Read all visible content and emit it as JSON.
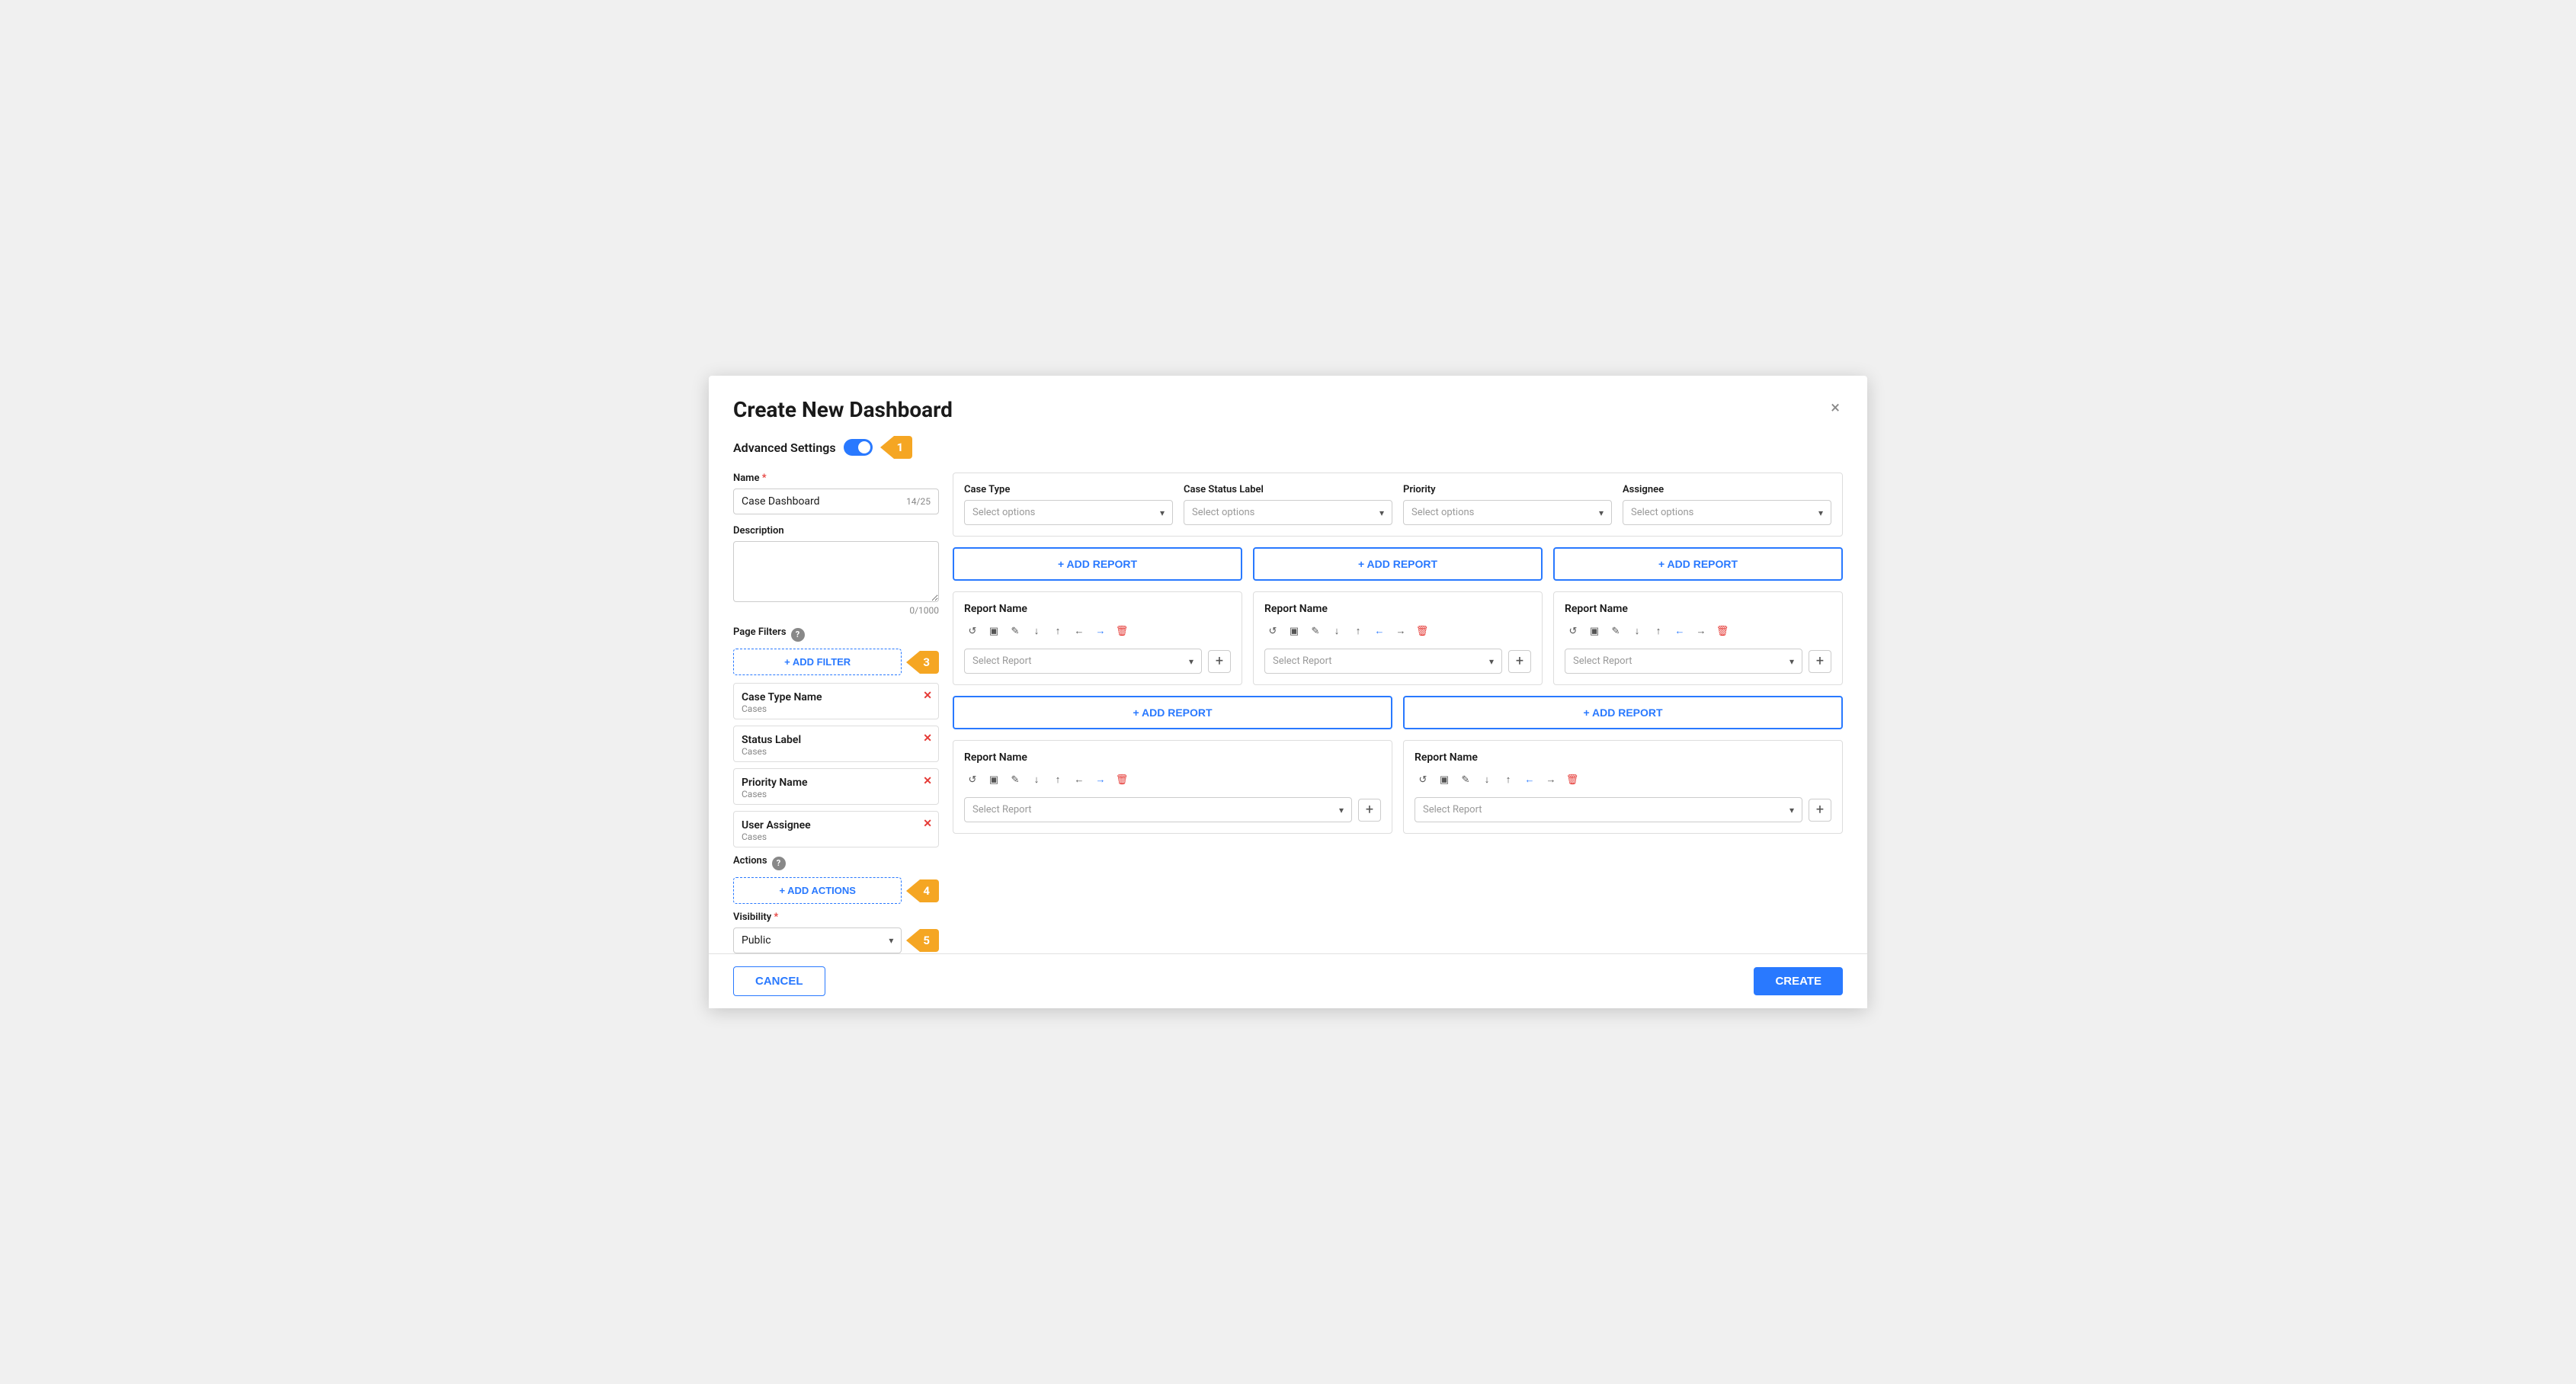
{
  "modal": {
    "title": "Create New Dashboard",
    "close_label": "×"
  },
  "advanced_settings": {
    "label": "Advanced Settings",
    "badge": "1",
    "toggle_on": true
  },
  "left_panel": {
    "name_label": "Name",
    "name_value": "Case Dashboard",
    "name_count": "14/25",
    "description_label": "Description",
    "description_placeholder": "",
    "description_count": "0/1000",
    "page_filters_label": "Page Filters",
    "add_filter_label": "+ ADD FILTER",
    "badge_filter": "3",
    "filters": [
      {
        "name": "Case Type Name",
        "sub": "Cases"
      },
      {
        "name": "Status Label",
        "sub": "Cases"
      },
      {
        "name": "Priority Name",
        "sub": "Cases"
      },
      {
        "name": "User Assignee",
        "sub": "Cases"
      }
    ],
    "actions_label": "Actions",
    "add_actions_label": "+ ADD ACTIONS",
    "badge_actions": "4",
    "visibility_label": "Visibility",
    "visibility_value": "Public",
    "badge_visibility": "5"
  },
  "right_panel": {
    "filter_bar": {
      "case_type_label": "Case Type",
      "case_type_placeholder": "Select options",
      "case_status_label": "Case Status Label",
      "case_status_placeholder": "Select options",
      "priority_label": "Priority",
      "priority_placeholder": "Select options",
      "assignee_label": "Assignee",
      "assignee_placeholder": "Select options"
    },
    "add_report_label": "+ ADD REPORT",
    "report_name_label": "Report Name",
    "select_report_placeholder": "Select Report",
    "reports_row1": [
      {
        "title": "Report Name"
      },
      {
        "title": "Report Name"
      },
      {
        "title": "Report Name"
      }
    ],
    "reports_row2": [
      {
        "title": "Report Name"
      },
      {
        "title": "Report Name"
      }
    ]
  },
  "footer": {
    "cancel_label": "CANCEL",
    "create_label": "CREATE"
  }
}
